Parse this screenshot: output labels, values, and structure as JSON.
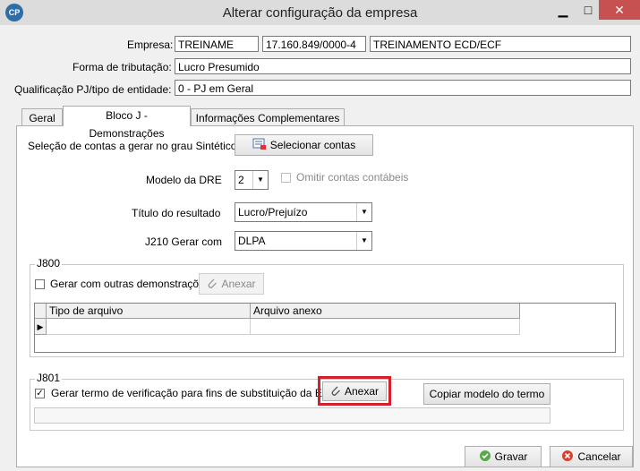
{
  "window": {
    "logo_text": "CP",
    "title": "Alterar configuração da empresa",
    "minimize": "▁",
    "maximize": "□",
    "close": "✕"
  },
  "company": {
    "empresa_label": "Empresa:",
    "code": "TREINAME",
    "cnpj": "17.160.849/0000-4",
    "name": "TREINAMENTO ECD/ECF",
    "tributacao_label": "Forma de tributação:",
    "tributacao": "Lucro Presumido",
    "qualificacao_label": "Qualificação PJ/tipo de entidade:",
    "qualificacao": "0 - PJ em Geral"
  },
  "tabs": [
    {
      "label": "Geral"
    },
    {
      "label": "Bloco J - Demonstrações"
    },
    {
      "label": "Informações Complementares"
    }
  ],
  "bloco_j": {
    "selecao_label": "Seleção de contas a gerar no grau Sintético",
    "selecionar_button": "Selecionar contas",
    "modelo_dre_label": "Modelo da DRE",
    "modelo_dre_value": "2",
    "omitir_label": "Omitir contas contábeis",
    "titulo_resultado_label": "Título do resultado",
    "titulo_resultado_value": "Lucro/Prejuízo",
    "j210_label": "J210 Gerar com",
    "j210_value": "DLPA"
  },
  "j800": {
    "title": "J800",
    "gerar_label": "Gerar com outras demonstrações",
    "anexar_button": "Anexar",
    "columns": [
      "Tipo de arquivo",
      "Arquivo anexo"
    ]
  },
  "j801": {
    "title": "J801",
    "gerar_label": "Gerar termo de verificação para fins de substituição da ECD",
    "anexar_button": "Anexar",
    "copiar_button": "Copiar modelo do termo",
    "highlight_color": "#d3202b"
  },
  "footer": {
    "gravar_button": "Gravar",
    "cancelar_button": "Cancelar"
  }
}
